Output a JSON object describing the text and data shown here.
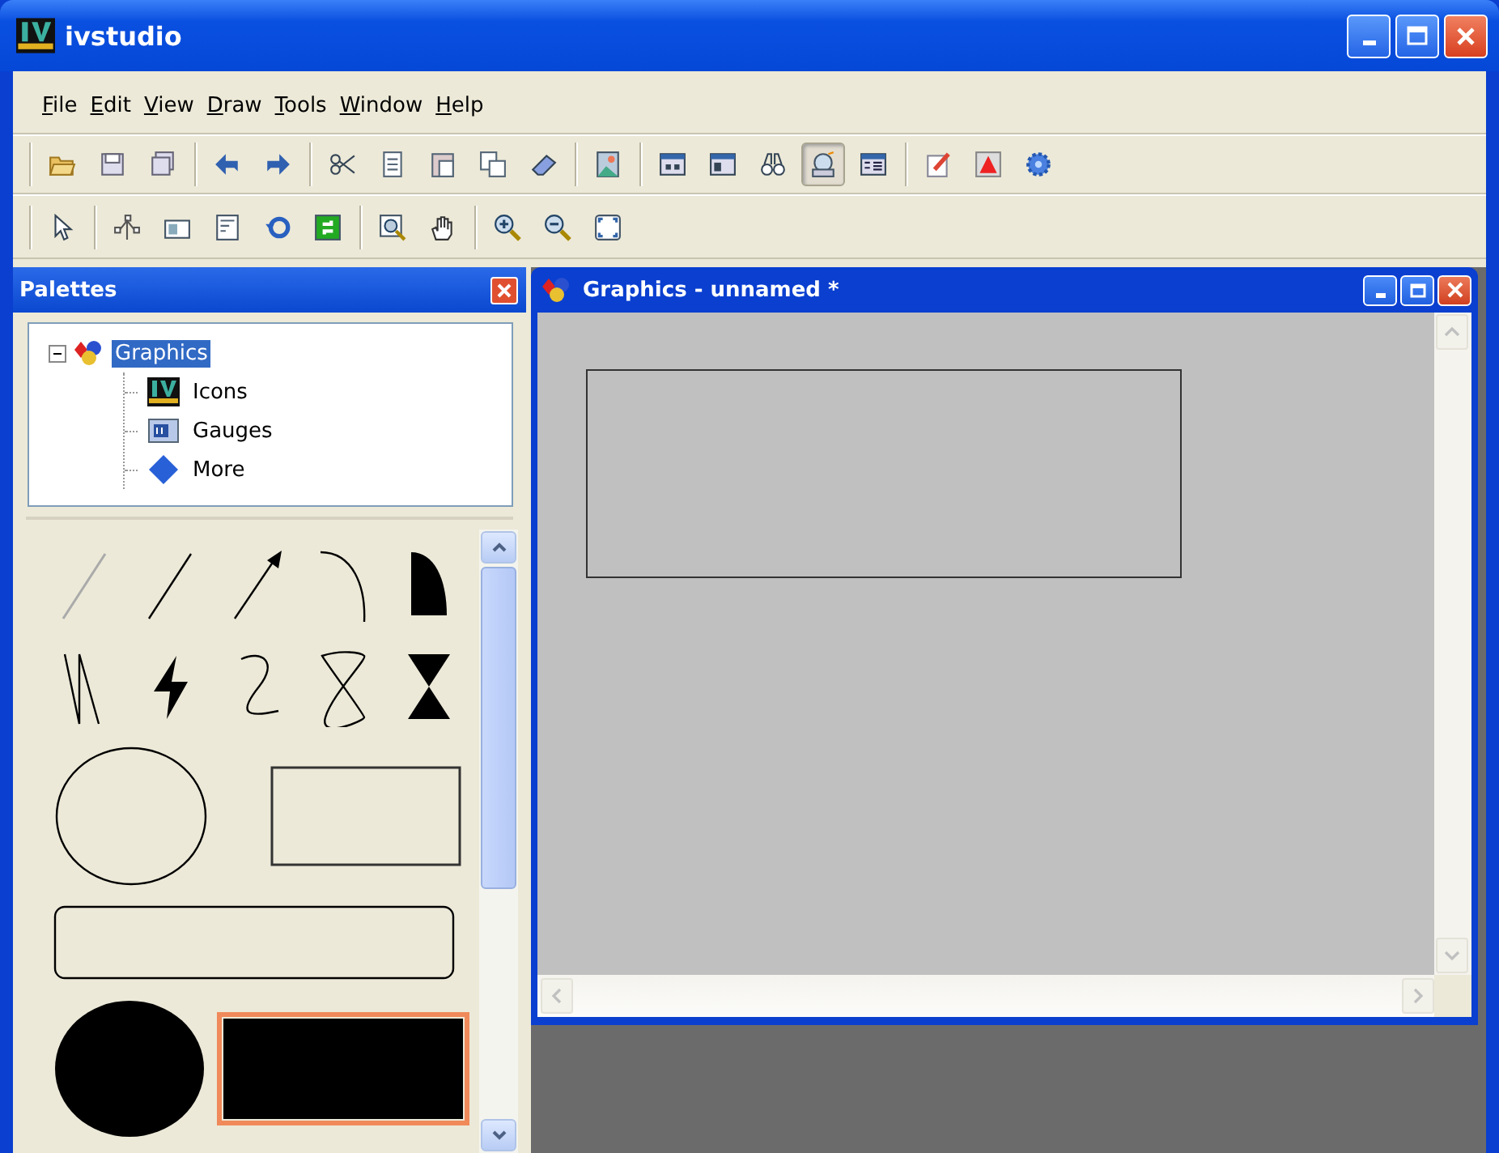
{
  "window": {
    "title": "ivstudio"
  },
  "menu": [
    "File",
    "Edit",
    "View",
    "Draw",
    "Tools",
    "Window",
    "Help"
  ],
  "toolbar_1": [
    [
      {
        "pressed": false
      },
      {
        "pressed": false
      },
      {
        "pressed": false
      }
    ],
    [
      {
        "pressed": false
      },
      {
        "pressed": false
      }
    ],
    [
      {
        "pressed": false
      },
      {
        "pressed": false
      },
      {
        "pressed": false
      },
      {
        "pressed": false
      },
      {
        "pressed": false
      }
    ],
    [
      {
        "pressed": false
      }
    ],
    [
      {
        "pressed": false
      },
      {
        "pressed": false
      },
      {
        "pressed": false
      },
      {
        "pressed": true
      },
      {
        "pressed": false
      }
    ],
    [
      {
        "pressed": false
      },
      {
        "pressed": false
      },
      {
        "pressed": false
      }
    ]
  ],
  "toolbar_2": [
    [
      {
        "pressed": false
      }
    ],
    [
      {
        "pressed": false
      },
      {
        "pressed": false
      },
      {
        "pressed": false
      },
      {
        "pressed": false
      },
      {
        "pressed": false
      }
    ],
    [
      {
        "pressed": false
      },
      {
        "pressed": false
      }
    ],
    [
      {
        "pressed": false
      },
      {
        "pressed": false
      },
      {
        "pressed": false
      }
    ]
  ],
  "palettes": {
    "title": "Palettes",
    "tree": [
      {
        "label": "Graphics",
        "selected": true,
        "expanded": true,
        "children": [
          {
            "label": "Icons",
            "selected": false
          },
          {
            "label": "Gauges",
            "selected": false
          },
          {
            "label": "More",
            "selected": false
          }
        ]
      }
    ],
    "items": [
      {
        "kind": "faint-line",
        "selected": false
      },
      {
        "kind": "line",
        "selected": false
      },
      {
        "kind": "arrow",
        "selected": false
      },
      {
        "kind": "arc",
        "selected": false
      },
      {
        "kind": "pie",
        "selected": false
      },
      {
        "kind": "polyline",
        "selected": false
      },
      {
        "kind": "bolt",
        "selected": false
      },
      {
        "kind": "spline",
        "selected": false
      },
      {
        "kind": "closed-spline",
        "selected": false
      },
      {
        "kind": "hourglass",
        "selected": false
      },
      {
        "kind": "ellipse",
        "selected": false
      },
      {
        "kind": "rectangle",
        "selected": false
      },
      {
        "kind": "rounded-rectangle",
        "selected": false
      },
      {
        "kind": "filled-ellipse",
        "selected": false
      },
      {
        "kind": "filled-rectangle",
        "selected": true
      }
    ]
  },
  "document": {
    "title": "Graphics - unnamed *"
  }
}
